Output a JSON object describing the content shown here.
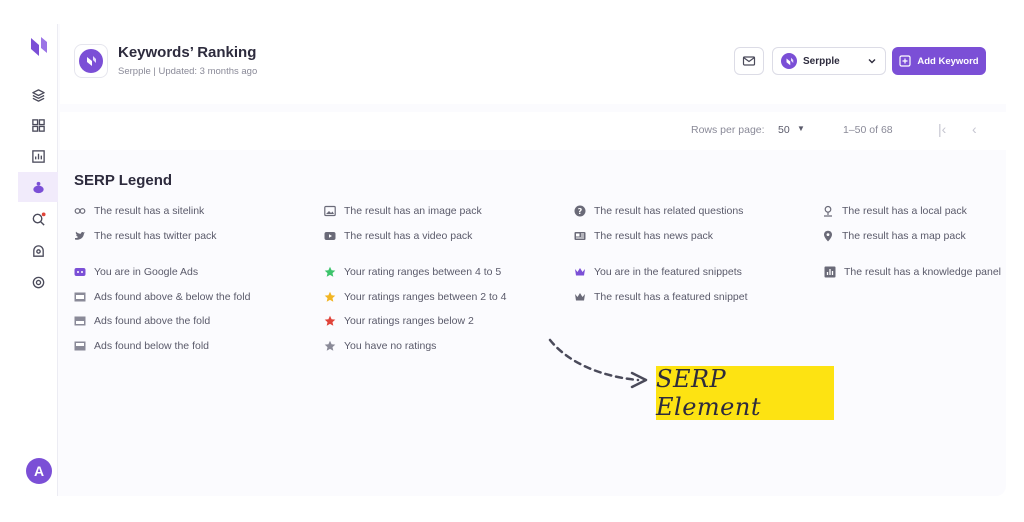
{
  "header": {
    "title": "Keywords’ Ranking",
    "subtitle": "Serpple | Updated: 3 months ago",
    "project_select": "Serpple",
    "add_button": "Add Keyword"
  },
  "pager": {
    "rows_label": "Rows per page:",
    "rows_value": "50",
    "range": "1–50 of 68"
  },
  "legend": {
    "title": "SERP Legend",
    "items": [
      {
        "label": "The result has a sitelink",
        "icon": "link-icon"
      },
      {
        "label": "The result has twitter pack",
        "icon": "twitter-icon"
      },
      {
        "label": "You are in Google Ads",
        "icon": "ads-icon"
      },
      {
        "label": "Ads found above & below the fold",
        "icon": "ads-above-below-icon"
      },
      {
        "label": "Ads found above the fold",
        "icon": "ads-above-icon"
      },
      {
        "label": "Ads found below the fold",
        "icon": "ads-below-icon"
      },
      {
        "label": "The result has an image pack",
        "icon": "image-icon"
      },
      {
        "label": "The result has a video pack",
        "icon": "video-icon"
      },
      {
        "label": "Your rating ranges between 4 to 5",
        "icon": "star-green-icon"
      },
      {
        "label": "Your ratings ranges between 2 to 4",
        "icon": "star-yellow-icon"
      },
      {
        "label": "Your ratings ranges below 2",
        "icon": "star-red-icon"
      },
      {
        "label": "You have no ratings",
        "icon": "star-gray-icon"
      },
      {
        "label": "The result has related questions",
        "icon": "question-icon"
      },
      {
        "label": "The result has news pack",
        "icon": "news-icon"
      },
      {
        "label": "You are in the featured snippets",
        "icon": "crown-purple-icon"
      },
      {
        "label": "The result has a featured snippet",
        "icon": "crown-gray-icon"
      },
      {
        "label": "The result has a local pack",
        "icon": "local-pin-icon"
      },
      {
        "label": "The result has a map pack",
        "icon": "map-pin-icon"
      },
      {
        "label": "The result has a knowledge panel",
        "icon": "knowledge-panel-icon"
      }
    ]
  },
  "callout": "SERP Element",
  "avatar_letter": "A",
  "colors": {
    "accent": "#7b4fd6",
    "callout_bg": "#fde312",
    "star_green": "#3cc46b",
    "star_yellow": "#f2b523",
    "star_red": "#e0443a",
    "star_gray": "#8a8a98"
  }
}
